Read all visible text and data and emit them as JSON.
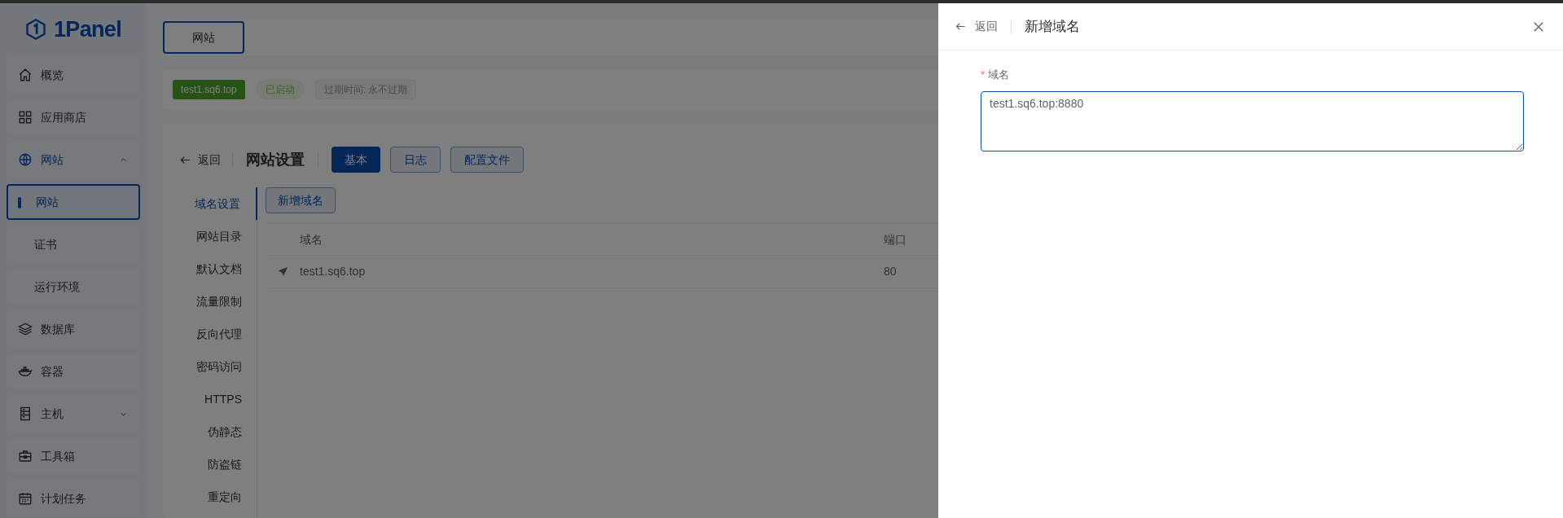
{
  "sidebar": {
    "logo": "1Panel",
    "items": [
      {
        "kind": "item",
        "label": "概览",
        "selected": false
      },
      {
        "kind": "item",
        "label": "应用商店",
        "selected": false
      },
      {
        "kind": "group",
        "label": "网站",
        "expanded": true,
        "children": [
          {
            "label": "网站",
            "selected": true
          },
          {
            "label": "证书",
            "selected": false
          },
          {
            "label": "运行环境",
            "selected": false
          }
        ]
      },
      {
        "kind": "item",
        "label": "数据库",
        "selected": false
      },
      {
        "kind": "item",
        "label": "容器",
        "selected": false
      },
      {
        "kind": "group",
        "label": "主机",
        "expanded": false
      },
      {
        "kind": "item",
        "label": "工具箱",
        "selected": false
      },
      {
        "kind": "item",
        "label": "计划任务",
        "selected": false
      }
    ]
  },
  "tabs": [
    {
      "label": "网站",
      "selected": true
    }
  ],
  "site_header": {
    "domain_tag": "test1.sq6.top",
    "status_tag": "已启动",
    "expiry_tag": "过期时间: 永不过期"
  },
  "settings": {
    "back": "返回",
    "title": "网站设置",
    "tabs": [
      {
        "label": "基本",
        "selected": true
      },
      {
        "label": "日志",
        "selected": false
      },
      {
        "label": "配置文件",
        "selected": false
      }
    ],
    "menu": [
      {
        "label": "域名设置",
        "selected": true
      },
      {
        "label": "网站目录",
        "selected": false
      },
      {
        "label": "默认文档",
        "selected": false
      },
      {
        "label": "流量限制",
        "selected": false
      },
      {
        "label": "反向代理",
        "selected": false
      },
      {
        "label": "密码访问",
        "selected": false
      },
      {
        "label": "HTTPS",
        "selected": false
      },
      {
        "label": "伪静态",
        "selected": false
      },
      {
        "label": "防盗链",
        "selected": false
      },
      {
        "label": "重定向",
        "selected": false
      }
    ],
    "add_button": "新增域名",
    "table": {
      "columns": [
        "域名",
        "端口"
      ],
      "rows": [
        [
          "test1.sq6.top",
          "80"
        ]
      ]
    }
  },
  "drawer": {
    "back": "返回",
    "title": "新增域名",
    "field": {
      "required_mark": "*",
      "label": "域名",
      "value": "test1.sq6.top:8880"
    }
  }
}
